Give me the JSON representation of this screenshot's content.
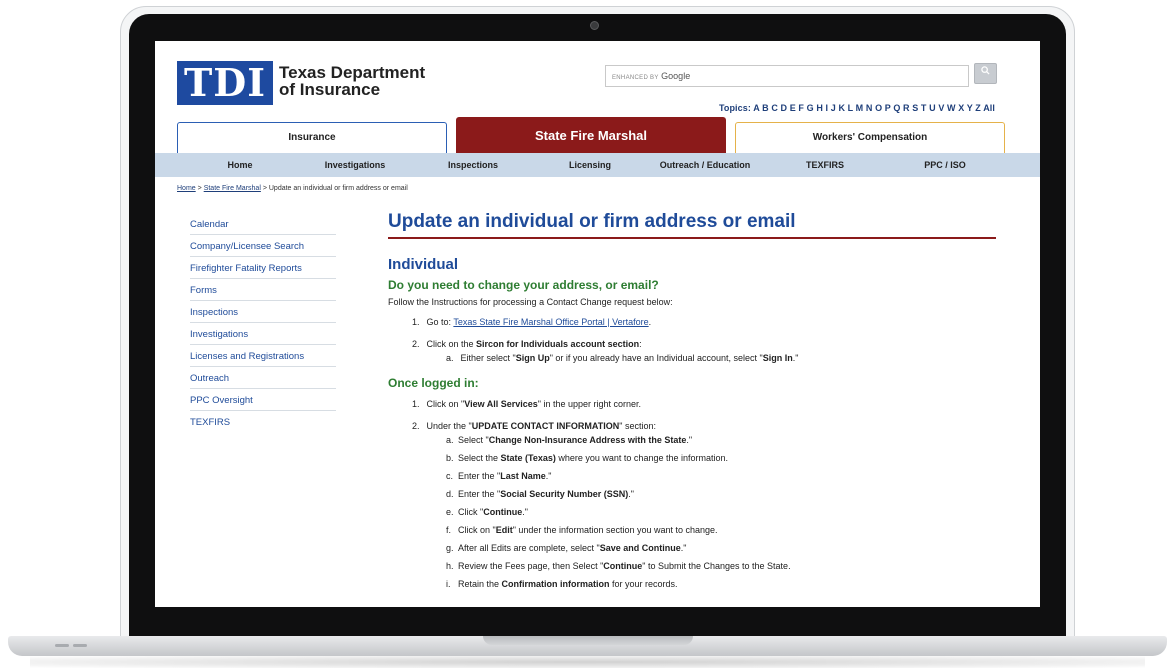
{
  "logo": {
    "mark": "TDI",
    "line1": "Texas Department",
    "line2": "of Insurance"
  },
  "search": {
    "enhanced_by": "ENHANCED BY",
    "google": "Google",
    "button_icon": "search-icon"
  },
  "topics": {
    "label": "Topics:",
    "letters": "A B C D E F G H I J K L M N O P Q R S T U V W X Y Z",
    "all": "All"
  },
  "tabs": [
    {
      "label": "Insurance"
    },
    {
      "label": "State Fire Marshal"
    },
    {
      "label": "Workers' Compensation"
    }
  ],
  "nav": [
    {
      "label": "Home"
    },
    {
      "label": "Investigations"
    },
    {
      "label": "Inspections"
    },
    {
      "label": "Licensing"
    },
    {
      "label": "Outreach / Education"
    },
    {
      "label": "TEXFIRS"
    },
    {
      "label": "PPC / ISO"
    }
  ],
  "breadcrumb": {
    "home": "Home",
    "sep": ">",
    "section": "State Fire Marshal",
    "current": "Update an individual or firm address or email"
  },
  "sidebar": [
    {
      "label": "Calendar"
    },
    {
      "label": "Company/Licensee Search"
    },
    {
      "label": "Firefighter Fatality Reports"
    },
    {
      "label": "Forms"
    },
    {
      "label": "Inspections"
    },
    {
      "label": "Investigations"
    },
    {
      "label": "Licenses and Registrations"
    },
    {
      "label": "Outreach"
    },
    {
      "label": "PPC Oversight"
    },
    {
      "label": "TEXFIRS"
    }
  ],
  "content": {
    "title": "Update an individual or firm address or email",
    "section": "Individual",
    "q_heading": "Do you need to change your address, or email?",
    "intro": "Follow the Instructions for processing a Contact Change request below:",
    "steps1": {
      "s1_pre": "Go to: ",
      "s1_link": "Texas State Fire Marshal Office Portal | Vertafore",
      "s1_post": ".",
      "s2_pre": "Click on the ",
      "s2_bold": "Sircon for Individuals account section",
      "s2_post": ":",
      "s2a_pre": "Either select \"",
      "s2a_b1": "Sign Up",
      "s2a_mid": "\" or if you already have an Individual account, select \"",
      "s2a_b2": "Sign In",
      "s2a_post": ".\""
    },
    "logged_heading": "Once logged in:",
    "steps2": {
      "s1_pre": "Click on \"",
      "s1_bold": "View All Services",
      "s1_post": "\" in the upper right corner.",
      "s2_pre": "Under the \"",
      "s2_bold": "UPDATE CONTACT INFORMATION",
      "s2_post": "\" section:",
      "a_pre": "Select \"",
      "a_bold": "Change Non-Insurance Address with the State",
      "a_post": ".\"",
      "b_pre": "Select the ",
      "b_bold": "State (Texas)",
      "b_post": " where you want to change the information.",
      "c_pre": "Enter the \"",
      "c_bold": "Last Name",
      "c_post": ".\"",
      "d_pre": "Enter the \"",
      "d_bold": "Social Security Number (SSN)",
      "d_post": ".\"",
      "e_pre": "Click \"",
      "e_bold": "Continue",
      "e_post": ".\"",
      "f_pre": "Click on \"",
      "f_bold": "Edit",
      "f_post": "\" under the information section you want to change.",
      "g_pre": "After all Edits are complete, select \"",
      "g_bold": "Save and Continue",
      "g_post": ".\"",
      "h_pre": "Review the Fees page, then Select \"",
      "h_bold": "Continue",
      "h_post": "\" to Submit the Changes to the State.",
      "i_pre": "Retain the ",
      "i_bold": "Confirmation information",
      "i_post": " for your records."
    }
  }
}
